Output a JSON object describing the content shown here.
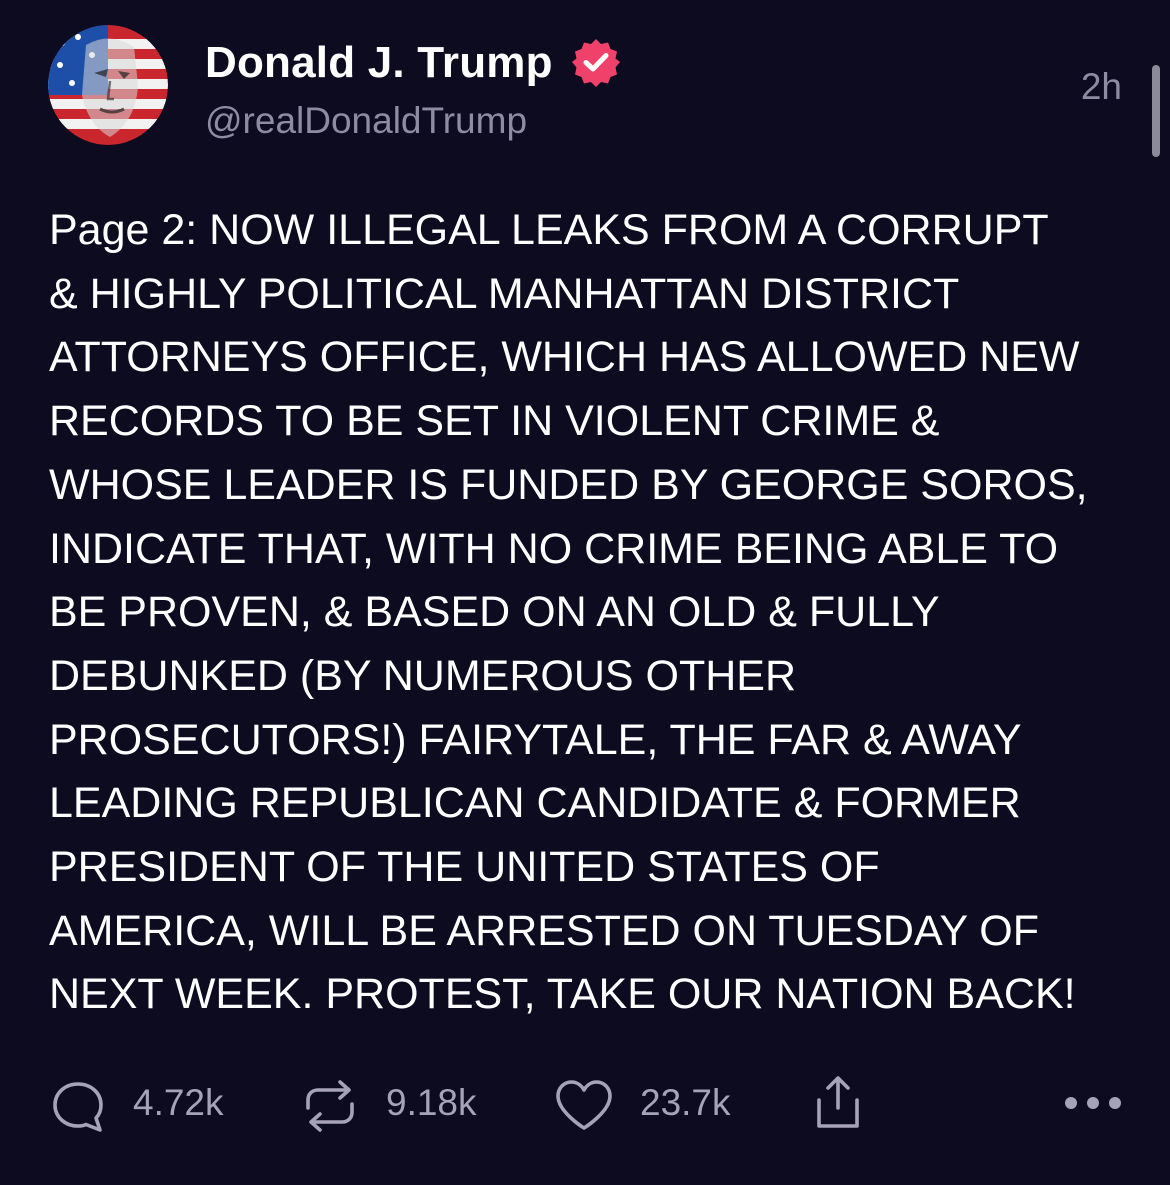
{
  "author": {
    "display_name": "Donald J. Trump",
    "handle": "@realDonaldTrump",
    "verified": true
  },
  "timestamp": "2h",
  "post": {
    "text": "Page 2: NOW ILLEGAL LEAKS FROM A CORRUPT\n& HIGHLY POLITICAL MANHATTAN DISTRICT\nATTORNEYS OFFICE, WHICH HAS ALLOWED NEW\nRECORDS TO BE SET IN VIOLENT CRIME &\nWHOSE LEADER IS FUNDED BY GEORGE SOROS,\nINDICATE THAT, WITH NO CRIME BEING ABLE TO\nBE PROVEN, & BASED ON AN OLD & FULLY\nDEBUNKED (BY NUMEROUS OTHER\nPROSECUTORS!) FAIRYTALE, THE FAR & AWAY\nLEADING REPUBLICAN CANDIDATE & FORMER\nPRESIDENT OF THE UNITED STATES OF\nAMERICA, WILL BE ARRESTED ON TUESDAY OF\nNEXT WEEK. PROTEST, TAKE OUR NATION BACK!"
  },
  "actions": {
    "reply": {
      "icon": "speech-bubble-icon",
      "count": "4.72k"
    },
    "repost": {
      "icon": "repost-arrows-icon",
      "count": "9.18k"
    },
    "like": {
      "icon": "heart-icon",
      "count": "23.7k"
    },
    "share": {
      "icon": "share-icon"
    },
    "more": {
      "icon": "more-dots-icon"
    }
  },
  "colors": {
    "background": "#0c0b1f",
    "text": "#ffffff",
    "secondary_text": "#8e8ba3",
    "verified_badge": "#f0416a"
  }
}
